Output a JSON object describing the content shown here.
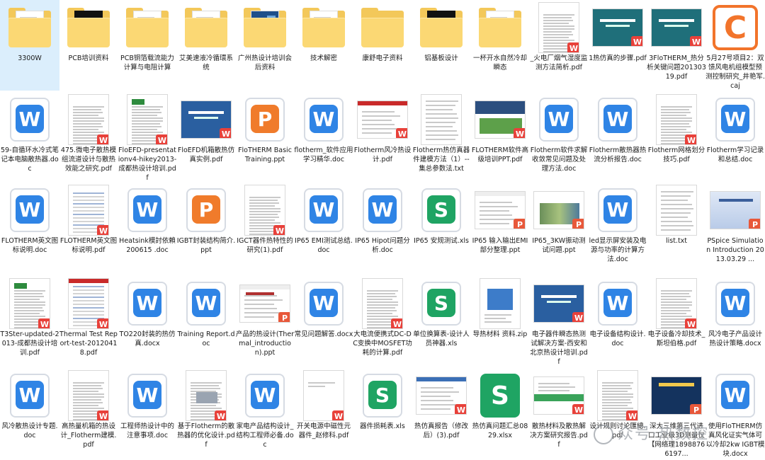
{
  "rows": [
    [
      {
        "label": "3300W",
        "type": "folder",
        "variant": "doc",
        "selected": true
      },
      {
        "label": "PCB培训资料",
        "type": "folder",
        "variant": "black"
      },
      {
        "label": "PCB铜箔载流能力计算与电阻计算",
        "type": "folder",
        "variant": "doc"
      },
      {
        "label": "艾美速液冷循環系统",
        "type": "folder",
        "variant": "doc"
      },
      {
        "label": "广州热设计培训会后资料",
        "type": "folder",
        "variant": "blue"
      },
      {
        "label": "技术解密",
        "type": "folder",
        "variant": "doc"
      },
      {
        "label": "康舒电子资料",
        "type": "folder",
        "variant": "plain"
      },
      {
        "label": "铝基板设计",
        "type": "folder",
        "variant": "black"
      },
      {
        "label": "一杯开水自然冷却瞬态",
        "type": "folder",
        "variant": "doc"
      },
      {
        "label": "_火电厂烟气湿度监测方法简析.pdf",
        "type": "doc",
        "style": "text",
        "badge": "pdf"
      },
      {
        "label": "1热仿真的步骤.pdf",
        "type": "doc",
        "style": "slide-teal",
        "badge": "pdf"
      },
      {
        "label": "3FloTHERM_热分析关键问题20130319.pdf",
        "type": "doc",
        "style": "slide-teal",
        "badge": "pdf"
      },
      {
        "label": "5月27号项目2：双馈风电机组模型预测控制研究_井艳军.caj",
        "type": "caj",
        "glyph": "C"
      }
    ],
    [
      {
        "label": "59-自循环水冷式笔记本电脑散热器.doc",
        "type": "app",
        "app": "w",
        "glyph": "W"
      },
      {
        "label": "475.微电子散热模组流道设计与散热效能之研究.pdf",
        "type": "doc",
        "style": "text",
        "badge": "pdf"
      },
      {
        "label": "FloEFD-presentationv4-hikey2013-成都热设计培训.pdf",
        "type": "doc",
        "style": "green-logo",
        "badge": "pdf"
      },
      {
        "label": "FloEFD机箱散热仿真实例.pdf",
        "type": "doc",
        "style": "slide-blue",
        "badge": "pdf"
      },
      {
        "label": "FloTHERM Basic Training.ppt",
        "type": "app",
        "app": "p",
        "glyph": "P"
      },
      {
        "label": "flotherm_软件应用学习精华.doc",
        "type": "app",
        "app": "w",
        "glyph": "W"
      },
      {
        "label": "Flotherm风冷热设计.pdf",
        "type": "doc",
        "style": "wide-red",
        "badge": "pdf"
      },
      {
        "label": "Flotherm热仿真器件建模方法（1）--集总参数法.txt",
        "type": "doc",
        "style": "plain-page"
      },
      {
        "label": "FLOTHERM软件高级培训PPT.pdf",
        "type": "doc",
        "style": "flomerics",
        "badge": "pdf"
      },
      {
        "label": "Flotherm软件求解收敛常见问题及处理方法.doc",
        "type": "app",
        "app": "w",
        "glyph": "W"
      },
      {
        "label": "Flotherm散热器热流分析报告.doc",
        "type": "app",
        "app": "w",
        "glyph": "W"
      },
      {
        "label": "Flotherm网格划分技巧.pdf",
        "type": "doc",
        "style": "text",
        "badge": "pdf"
      },
      {
        "label": "Flotherm学习记录和总结.doc",
        "type": "app",
        "app": "w",
        "glyph": "W"
      }
    ],
    [
      {
        "label": "FLOTHERM英文图标说明.doc",
        "type": "app",
        "app": "w",
        "glyph": "W"
      },
      {
        "label": "FLOTHERM英文图标说明.pdf",
        "type": "doc",
        "style": "table",
        "badge": "pdf"
      },
      {
        "label": "Heatsink模討依賴200615 .doc",
        "type": "app",
        "app": "w",
        "glyph": "W"
      },
      {
        "label": "IGBT封装结构简介.ppt",
        "type": "app",
        "app": "p",
        "glyph": "P"
      },
      {
        "label": "IGCT器件热特性的研究(1).pdf",
        "type": "doc",
        "style": "text",
        "badge": "pdf"
      },
      {
        "label": "IP65 EMI测试总结.doc",
        "type": "app",
        "app": "w",
        "glyph": "W"
      },
      {
        "label": "IP65 Hipot问题分析.doc",
        "type": "app",
        "app": "w",
        "glyph": "W"
      },
      {
        "label": "IP65 安规测试.xls",
        "type": "app",
        "app": "s",
        "glyph": "S"
      },
      {
        "label": "IP65 输入输出EMI部分整理.ppt",
        "type": "doc",
        "style": "wide-white",
        "badge": "ppt"
      },
      {
        "label": "IP65_3KW振动测试问题.ppt",
        "type": "doc",
        "style": "wide-photo",
        "badge": "ppt"
      },
      {
        "label": "led显示屏安装及电源与功率的计算方法.doc",
        "type": "app",
        "app": "w",
        "glyph": "W"
      },
      {
        "label": "list.txt",
        "type": "doc",
        "style": "plain-page"
      },
      {
        "label": "PSpice Simulation Introduction 2013.03.29 ...",
        "type": "doc",
        "style": "wide-pspice",
        "badge": "ppt"
      }
    ],
    [
      {
        "label": "T3Ster-updated-2013-成都热设计培训.pdf",
        "type": "doc",
        "style": "green-logo",
        "badge": "pdf"
      },
      {
        "label": "Thermal Test Report-test-20120418.pdf",
        "type": "doc",
        "style": "table-red",
        "badge": "pdf"
      },
      {
        "label": "TO220封装的热仿真.docx",
        "type": "app",
        "app": "w",
        "glyph": "W"
      },
      {
        "label": "Training Report.doc",
        "type": "app",
        "app": "w",
        "glyph": "W"
      },
      {
        "label": "产品的热设计(Thermal_introduction).ppt",
        "type": "doc",
        "style": "wide-intro",
        "badge": "ppt"
      },
      {
        "label": "常见问题解答.docx",
        "type": "app",
        "app": "w",
        "glyph": "W"
      },
      {
        "label": "大电流便携式DC-DC变换中MOSFET功耗的计算.pdf",
        "type": "doc",
        "style": "text",
        "badge": "pdf"
      },
      {
        "label": "单位换算表-设计人员神器.xls",
        "type": "app",
        "app": "s",
        "glyph": "S"
      },
      {
        "label": "导热材料 资料.zip",
        "type": "doc",
        "style": "zip"
      },
      {
        "label": "电子器件瞬态热测试解决方案-西安和北京热设计培训.pdf",
        "type": "doc",
        "style": "slide-blue",
        "badge": "pdf"
      },
      {
        "label": "电子设备结构设计.doc",
        "type": "app",
        "app": "w",
        "glyph": "W"
      },
      {
        "label": "电子设备冷却技术_斯坦伯格.pdf",
        "type": "doc",
        "style": "text",
        "badge": "pdf"
      },
      {
        "label": "风冷电子产品设计热设计策略.docx",
        "type": "app",
        "app": "w",
        "glyph": "W"
      }
    ],
    [
      {
        "label": "风冷散热设计专题.doc",
        "type": "app",
        "app": "w",
        "glyph": "W"
      },
      {
        "label": "高热量机箱的热设计_Flotherm建模.pdf",
        "type": "doc",
        "style": "text",
        "badge": "pdf"
      },
      {
        "label": "工程师热设计中的注意事项.doc",
        "type": "app",
        "app": "w",
        "glyph": "W"
      },
      {
        "label": "基于Flotherm的散热器的优化设计.pdf",
        "type": "doc",
        "style": "figure",
        "badge": "pdf"
      },
      {
        "label": "家电产品结构设计_结构工程师必备.doc",
        "type": "app",
        "app": "w",
        "glyph": "W"
      },
      {
        "label": "开关电源中磁性元器件_赵修科.pdf",
        "type": "doc",
        "style": "sparse",
        "badge": "pdf"
      },
      {
        "label": "器件损耗表.xls",
        "type": "app",
        "app": "s",
        "glyph": "S"
      },
      {
        "label": "热仿真报告（修改后）(3).pdf",
        "type": "doc",
        "style": "wide-report",
        "badge": "pdf"
      },
      {
        "label": "热仿真问题汇总0829.xlsx",
        "type": "app",
        "app": "sfull",
        "glyph": "S"
      },
      {
        "label": "散热材料及散热解决方案研究报告.pdf",
        "type": "doc",
        "style": "green-band",
        "badge": "pdf"
      },
      {
        "label": "设计规则讨论匯總.pdf",
        "type": "doc",
        "style": "text",
        "badge": "pdf"
      },
      {
        "label": "深大三维第三代进口工业级3D测量仪【网络理18988766197...",
        "type": "doc",
        "style": "dark-product",
        "badge": "ppt"
      },
      {
        "label": "使用FloTHERM仿真风化证实气体可以冷却2kw IGBT模块.docx",
        "type": "app",
        "app": "w",
        "glyph": "W"
      }
    ]
  ],
  "watermark": {
    "text": "众号·热数控"
  }
}
